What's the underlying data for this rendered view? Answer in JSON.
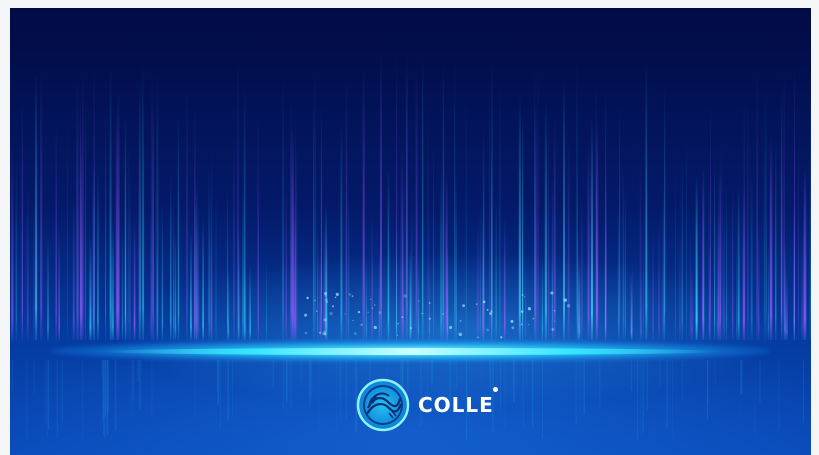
{
  "logo": {
    "brand_name": "COLLE",
    "mark_icon": "colle-logo-icon"
  },
  "colors": {
    "background_top": "#020b44",
    "background_bottom": "#0a4bbb",
    "glow_cyan": "#39e6ff",
    "ray_violet": "#9a5cff",
    "ray_cyan": "#35d8ff",
    "logo_ring": "#2fd4ff"
  }
}
